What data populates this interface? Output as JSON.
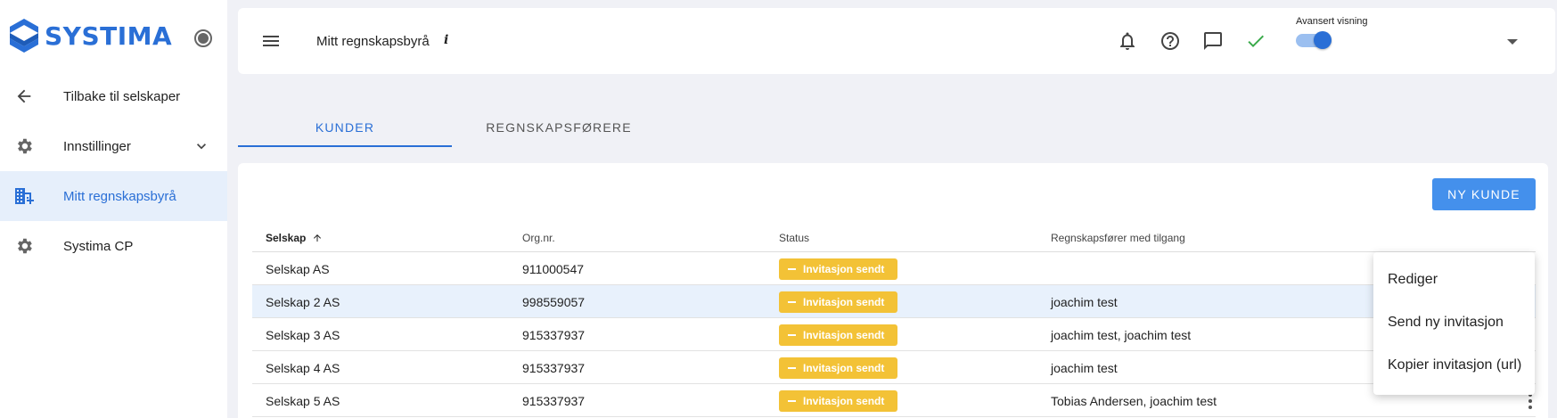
{
  "brand": {
    "name": "SYSTIMA",
    "color": "#2a6fd6"
  },
  "sidebar": {
    "items": [
      {
        "label": "Tilbake til selskaper",
        "icon": "arrow-left-icon"
      },
      {
        "label": "Innstillinger",
        "icon": "gear-icon",
        "expandable": true
      },
      {
        "label": "Mitt regnskapsbyrå",
        "icon": "building-icon",
        "active": true
      },
      {
        "label": "Systima CP",
        "icon": "gear-icon"
      }
    ]
  },
  "topbar": {
    "title": "Mitt regnskapsbyrå",
    "info": "i",
    "advanced_view_label": "Avansert visning",
    "advanced_view_on": true,
    "icons": [
      "bell-icon",
      "help-icon",
      "chat-icon",
      "check-icon"
    ]
  },
  "tabs": [
    {
      "label": "KUNDER",
      "active": true
    },
    {
      "label": "REGNSKAPSFØRERE",
      "active": false
    }
  ],
  "toolbar": {
    "new_customer_label": "NY KUNDE"
  },
  "table": {
    "columns": [
      "Selskap",
      "Org.nr.",
      "Status",
      "Regnskapsfører med tilgang"
    ],
    "sorted_column": "Selskap",
    "rows": [
      {
        "company": "Selskap AS",
        "org": "911000547",
        "status": "Invitasjon sendt",
        "accountants": ""
      },
      {
        "company": "Selskap 2 AS",
        "org": "998559057",
        "status": "Invitasjon sendt",
        "accountants": "joachim test"
      },
      {
        "company": "Selskap 3 AS",
        "org": "915337937",
        "status": "Invitasjon sendt",
        "accountants": "joachim test, joachim test"
      },
      {
        "company": "Selskap 4 AS",
        "org": "915337937",
        "status": "Invitasjon sendt",
        "accountants": "joachim test"
      },
      {
        "company": "Selskap 5 AS",
        "org": "915337937",
        "status": "Invitasjon sendt",
        "accountants": "Tobias Andersen, joachim test"
      }
    ]
  },
  "context_menu": {
    "items": [
      "Rediger",
      "Send ny invitasjon",
      "Kopier invitasjon (url)"
    ]
  },
  "colors": {
    "accent": "#2a6fd6",
    "button": "#4490ec",
    "badge": "#f3c236",
    "highlight_row": "#e8f1fc"
  }
}
